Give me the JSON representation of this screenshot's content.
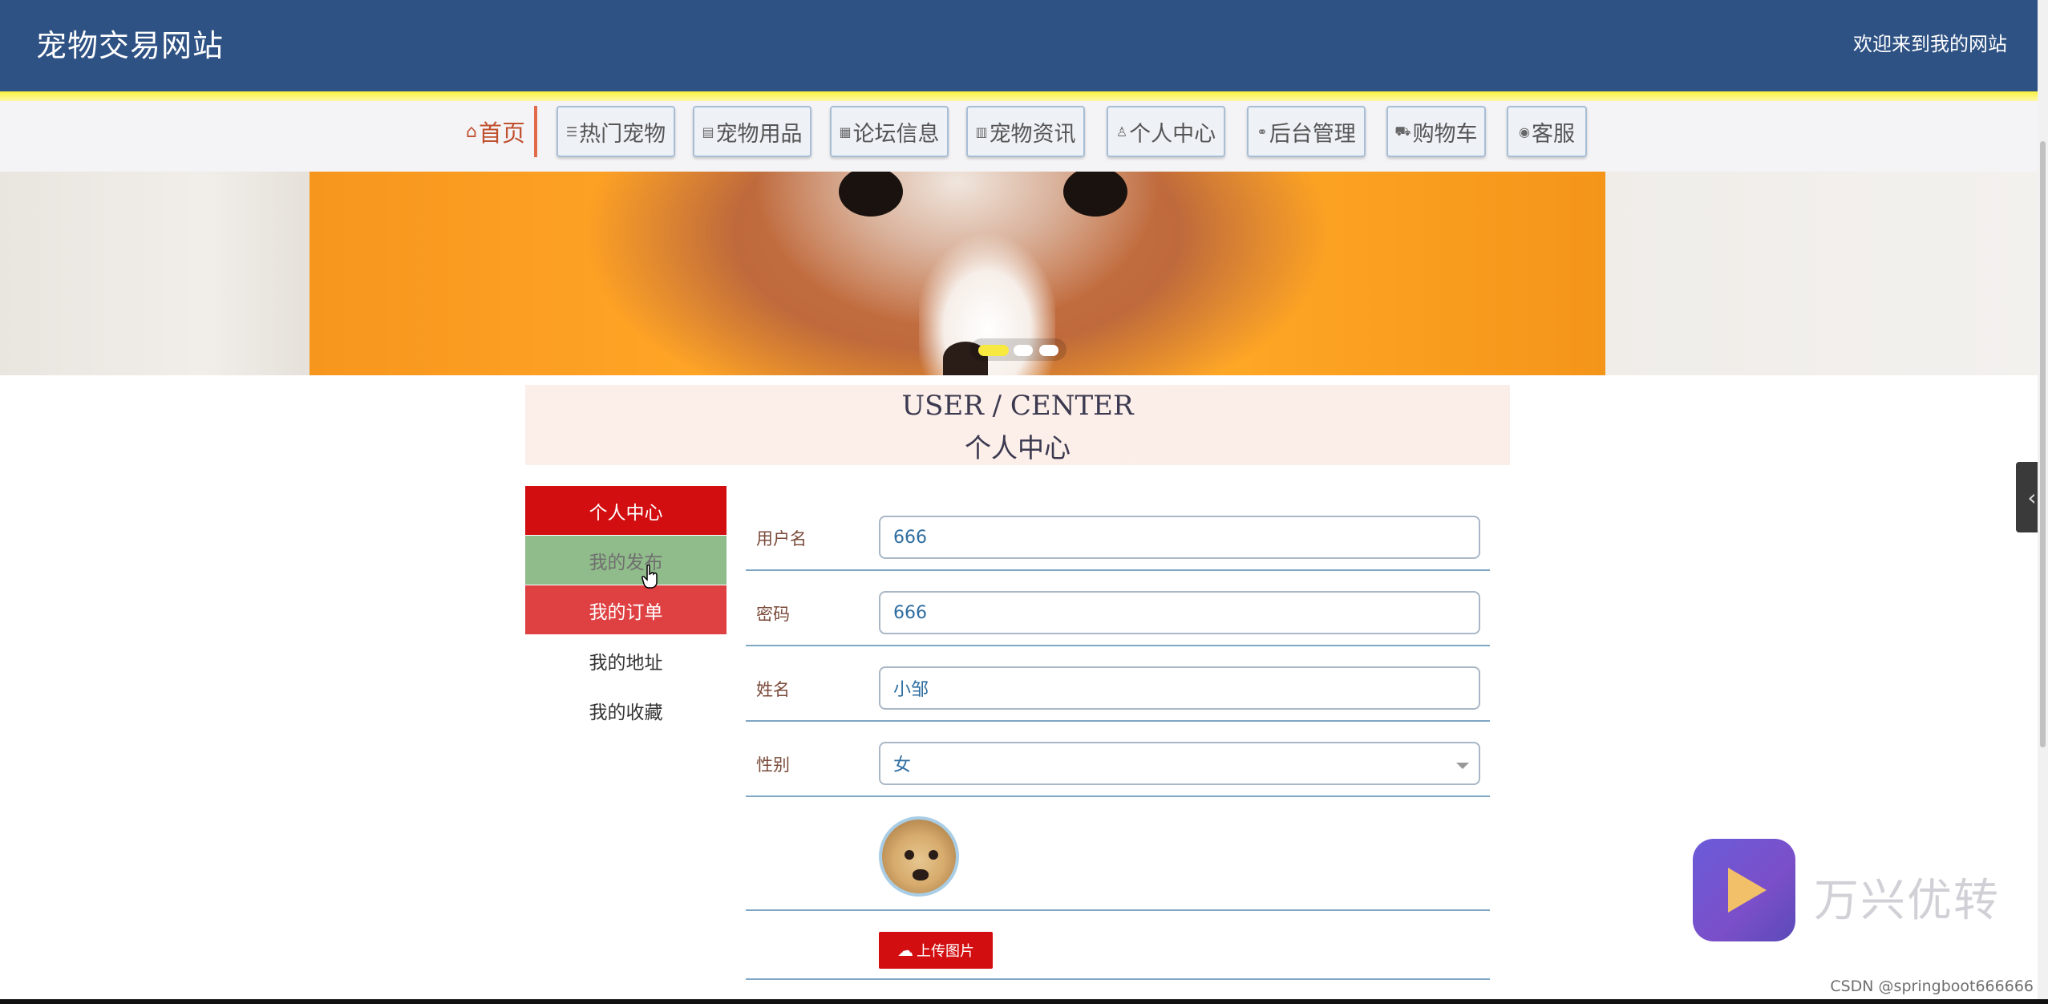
{
  "header": {
    "site_title": "宠物交易网站",
    "welcome": "欢迎来到我的网站"
  },
  "nav": [
    {
      "label": "首页",
      "icon": "home-icon",
      "active": true
    },
    {
      "label": "热门宠物",
      "icon": "sliders-icon"
    },
    {
      "label": "宠物用品",
      "icon": "document-icon"
    },
    {
      "label": "论坛信息",
      "icon": "grid-icon"
    },
    {
      "label": "宠物资讯",
      "icon": "newspaper-icon"
    },
    {
      "label": "个人中心",
      "icon": "user-icon"
    },
    {
      "label": "后台管理",
      "icon": "link-icon"
    },
    {
      "label": "购物车",
      "icon": "cart-icon"
    },
    {
      "label": "客服",
      "icon": "chat-icon"
    }
  ],
  "banner": {
    "slide_count": 3,
    "active_slide": 1
  },
  "section": {
    "title_en": "USER / CENTER",
    "title_cn": "个人中心"
  },
  "side_menu": [
    {
      "label": "个人中心",
      "state": "selected"
    },
    {
      "label": "我的发布",
      "state": "hover"
    },
    {
      "label": "我的订单",
      "state": "highlighted"
    },
    {
      "label": "我的地址"
    },
    {
      "label": "我的收藏"
    }
  ],
  "form": {
    "username": {
      "label": "用户名",
      "value": "666"
    },
    "password": {
      "label": "密码",
      "value": "666"
    },
    "name": {
      "label": "姓名",
      "value": "小邹"
    },
    "gender": {
      "label": "性别",
      "value": "女"
    },
    "upload_button": "上传图片"
  },
  "watermark": {
    "brand_text": "万兴优转",
    "credit": "CSDN @springboot666666"
  },
  "colors": {
    "header_bg": "#2f5284",
    "accent_red": "#d20e11",
    "hover_green": "#90bb8a",
    "order_red": "#df4143",
    "title_bg": "#fcefe9"
  }
}
